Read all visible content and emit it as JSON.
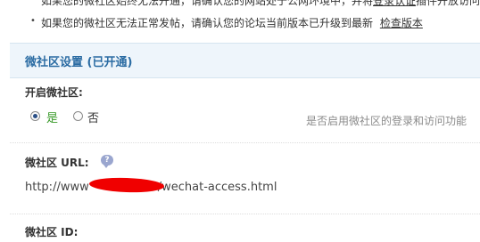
{
  "tips": {
    "line1_partial": "如果您的微社区始终无法开通，请确认您的网站处于公网环境中，并将",
    "line1_link_partial": "登录认证",
    "line1_tail_partial": "插件开放访问",
    "line2_text": "如果您的微社区无法正常发帖，请确认您的论坛当前版本已升级到最新",
    "line2_link": "检查版本",
    "bullet": "•"
  },
  "section": {
    "title": "微社区设置 (已开通)"
  },
  "enable": {
    "label": "开启微社区:",
    "option_yes": "是",
    "option_no": "否",
    "selected": "是",
    "hint": "是否启用微社区的登录和访问功能"
  },
  "url": {
    "label": "微社区 URL:",
    "info_icon": "info-icon",
    "value_prefix": "http://www",
    "value_suffix": "/wechat-access.html"
  },
  "id_field": {
    "label": "微社区 ID:"
  },
  "colors": {
    "section_title": "#2b6ca3",
    "section_bg": "#eef5fb",
    "yes_green": "#3a9a2a",
    "redaction": "#f00000",
    "hint_gray": "#8a8a8a"
  }
}
